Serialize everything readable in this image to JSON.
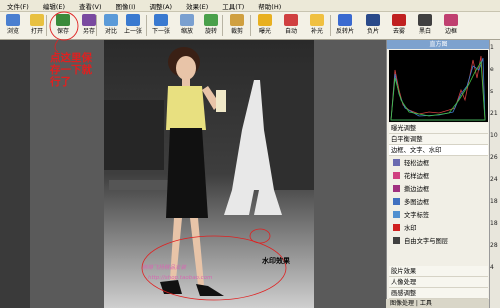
{
  "menu": [
    "文件(F)",
    "编辑(E)",
    "查看(V)",
    "图像(I)",
    "调整(A)",
    "效果(E)",
    "工具(T)",
    "帮助(H)"
  ],
  "toolbar": [
    {
      "label": "浏览",
      "icon": "browse-icon",
      "color": "#4a7fd0"
    },
    {
      "label": "打开",
      "icon": "folder-open-icon",
      "color": "#e8c040"
    },
    {
      "label": "保存",
      "icon": "save-icon",
      "color": "#3a8a3a"
    },
    {
      "label": "另存",
      "icon": "save-as-icon",
      "color": "#7a4aa0"
    },
    {
      "label": "对比",
      "icon": "compare-icon",
      "color": "#5a9ad8"
    },
    {
      "label": "上一张",
      "icon": "prev-icon",
      "color": "#3a7ad0"
    },
    {
      "label": "下一张",
      "icon": "next-icon",
      "color": "#3a7ad0"
    },
    {
      "label": "缩放",
      "icon": "zoom-icon",
      "color": "#7aa0d0"
    },
    {
      "label": "旋转",
      "icon": "rotate-icon",
      "color": "#4aa04a"
    },
    {
      "label": "裁剪",
      "icon": "crop-icon",
      "color": "#d0a040"
    },
    {
      "label": "曝光",
      "icon": "exposure-icon",
      "color": "#e8b020"
    },
    {
      "label": "自动",
      "icon": "auto-icon",
      "color": "#d04040"
    },
    {
      "label": "补光",
      "icon": "fill-light-icon",
      "color": "#f0c040"
    },
    {
      "label": "反转片",
      "icon": "invert-icon",
      "color": "#3a6ad0"
    },
    {
      "label": "负片",
      "icon": "negative-icon",
      "color": "#2a4a8a"
    },
    {
      "label": "去雾",
      "icon": "dehaze-icon",
      "color": "#c02020"
    },
    {
      "label": "黑白",
      "icon": "bw-icon",
      "color": "#404040"
    },
    {
      "label": "边框",
      "icon": "frame-icon",
      "color": "#c04070"
    }
  ],
  "annotation": {
    "lines": [
      "点这里保",
      "存一下就",
      "行了"
    ]
  },
  "watermark_label": "水印效果",
  "watermark_text": [
    "琳琳飞扬精品女装",
    "http://shop.taobao.com"
  ],
  "panel": {
    "title": "直方图",
    "rows": [
      "曝光调整",
      "白平衡调整",
      "边框、文字、水印"
    ],
    "items": [
      {
        "label": "轻松边框",
        "color": "#6a6ab0"
      },
      {
        "label": "花样边框",
        "color": "#d04080"
      },
      {
        "label": "撕边边框",
        "color": "#a03080"
      },
      {
        "label": "多图边框",
        "color": "#4070c0"
      },
      {
        "label": "文字标签",
        "color": "#5090d0"
      },
      {
        "label": "水印",
        "color": "#d02020"
      },
      {
        "label": "自由文字与图层",
        "color": "#404040"
      }
    ],
    "bottom_rows": [
      "胶片效果",
      "人像处理",
      "画感调整"
    ],
    "tabs": "图像处理 | 工具"
  },
  "right_numbers": [
    "1",
    "e",
    "s",
    "21",
    "10",
    "26",
    "24",
    "18",
    "18",
    "28",
    "4"
  ],
  "colors": {
    "accent_annotation": "#e02020",
    "panel_title": "#7da2ce"
  }
}
